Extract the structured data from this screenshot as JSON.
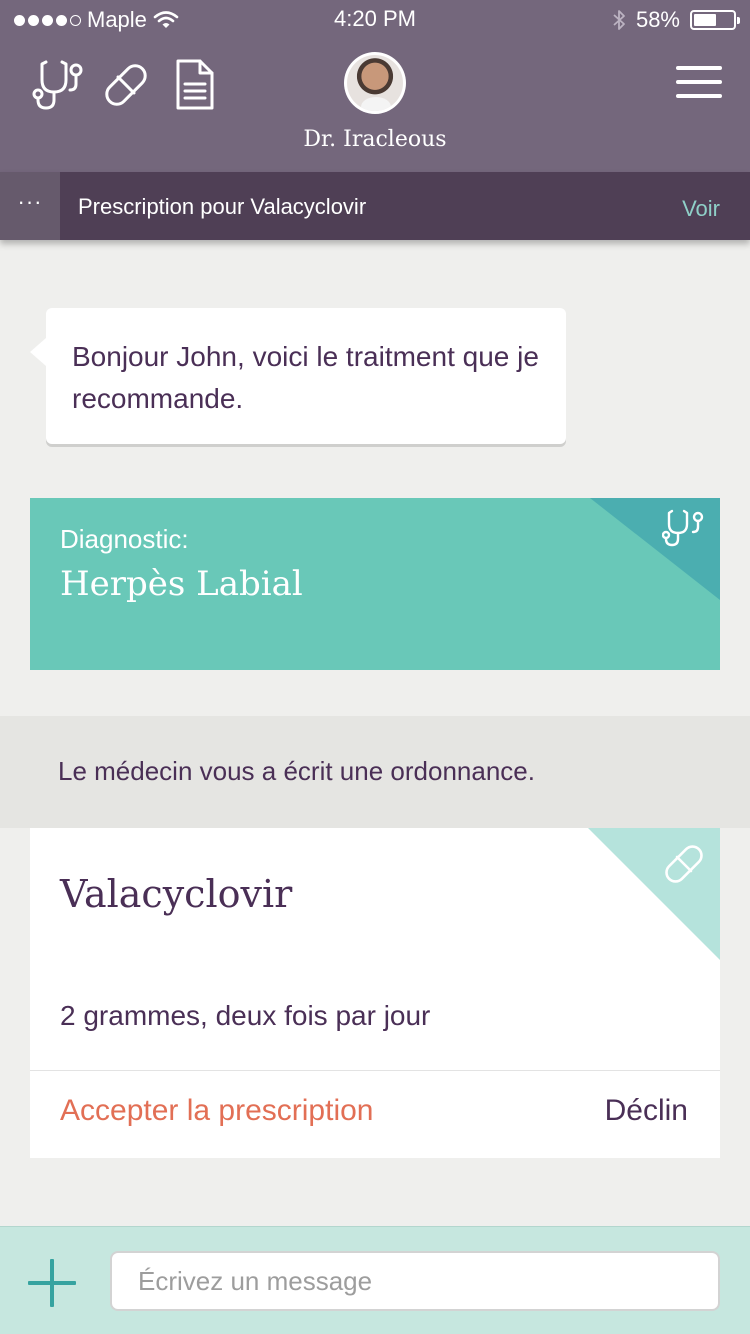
{
  "status_bar": {
    "carrier": "Maple",
    "time": "4:20 PM",
    "battery_percent_label": "58%",
    "battery_level": 0.58
  },
  "header": {
    "doctor_name": "Dr. Iracleous",
    "icons": [
      "stethoscope-icon",
      "pill-icon",
      "document-icon",
      "menu-icon"
    ]
  },
  "subbar": {
    "more": "···",
    "title": "Prescription pour Valacyclovir",
    "action": "Voir"
  },
  "message": {
    "text": "Bonjour John, voici le traitment que je recommande."
  },
  "diagnostic": {
    "label": "Diagnostic:",
    "value": "Herpès Labial"
  },
  "notice": {
    "text": "Le médecin vous a écrit une ordonnance."
  },
  "prescription": {
    "drug": "Valacyclovir",
    "dosage": "2 grammes, deux fois par jour",
    "accept_label": "Accepter la prescription",
    "decline_label": "Déclin"
  },
  "composer": {
    "placeholder": "Écrivez un message"
  },
  "colors": {
    "header": "#74677c",
    "subbar": "#4f3f55",
    "diagnostic": "#69c8b8",
    "accent_text": "#4a2f56",
    "accept": "#e26f55",
    "teal": "#36a3a0"
  }
}
